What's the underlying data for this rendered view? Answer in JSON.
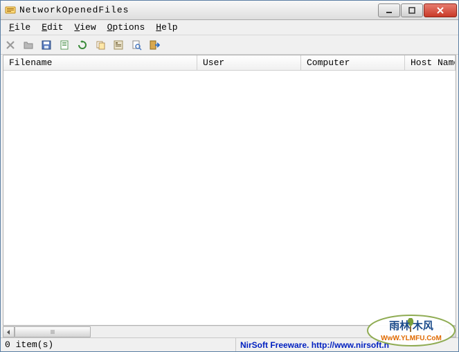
{
  "window": {
    "title": "NetworkOpenedFiles"
  },
  "menu": {
    "file": "File",
    "edit": "Edit",
    "view": "View",
    "options": "Options",
    "help": "Help"
  },
  "toolbar_icons": [
    "close",
    "open",
    "save",
    "page",
    "refresh",
    "copy",
    "properties",
    "find",
    "exit"
  ],
  "columns": {
    "filename": "Filename",
    "user": "User",
    "computer": "Computer",
    "hostname": "Host Name"
  },
  "rows": [],
  "status": {
    "count": "0 item(s)",
    "credit": "NirSoft Freeware. http://www.nirsoft.n"
  },
  "watermark": {
    "cn": "雨林   木风",
    "url": "WwW.YLMFU.CoM"
  }
}
